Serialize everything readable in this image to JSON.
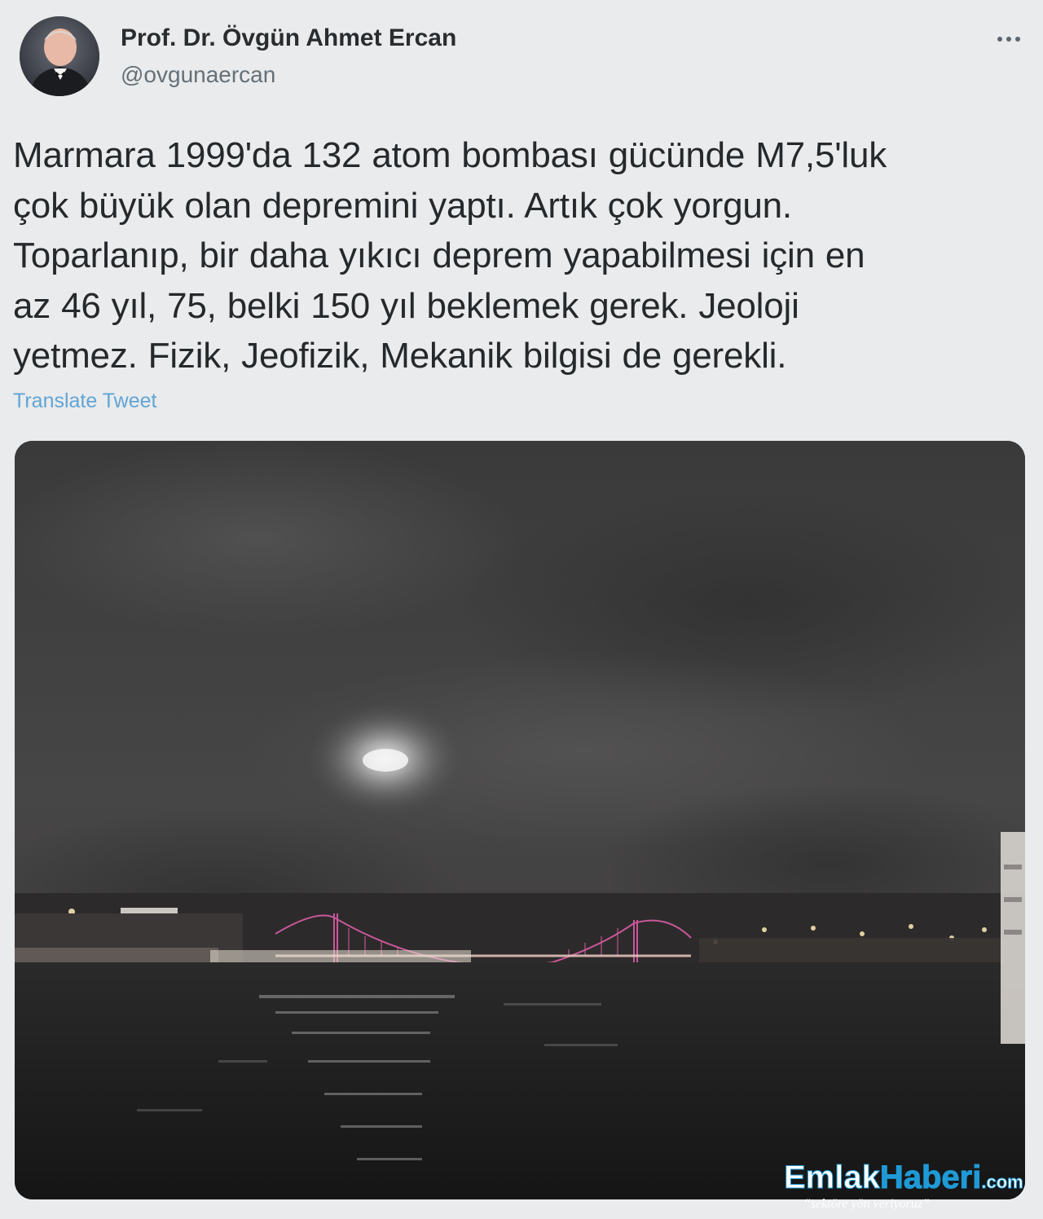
{
  "tweet": {
    "author": {
      "display_name": "Prof. Dr. Övgün Ahmet Ercan",
      "handle": "@ovgunaercan"
    },
    "more_icon": "more-horizontal-icon",
    "text_lines": [
      "Marmara 1999'da 132 atom bombası gücünde M7,5'luk",
      "çok büyük olan depremini yaptı. Artık çok yorgun.",
      "Toparlanıp, bir daha yıkıcı deprem yapabilmesi için en",
      "az 46 yıl, 75, belki 150 yıl beklemek gerek. Jeoloji",
      "yetmez. Fizik, Jeofizik, Mekanik bilgisi de gerekli."
    ],
    "translate_label": "Translate Tweet"
  },
  "watermark": {
    "brand_emlak": "Emlak",
    "brand_haberi": "Haberi",
    "brand_domain": ".com",
    "slogan": "“sektöre yön veriyoruz”"
  },
  "colors": {
    "background": "#e9ebec",
    "link": "#62a4d4",
    "bridge_lights": "#d15a9e",
    "watermark_blue": "#1f9ad6"
  }
}
